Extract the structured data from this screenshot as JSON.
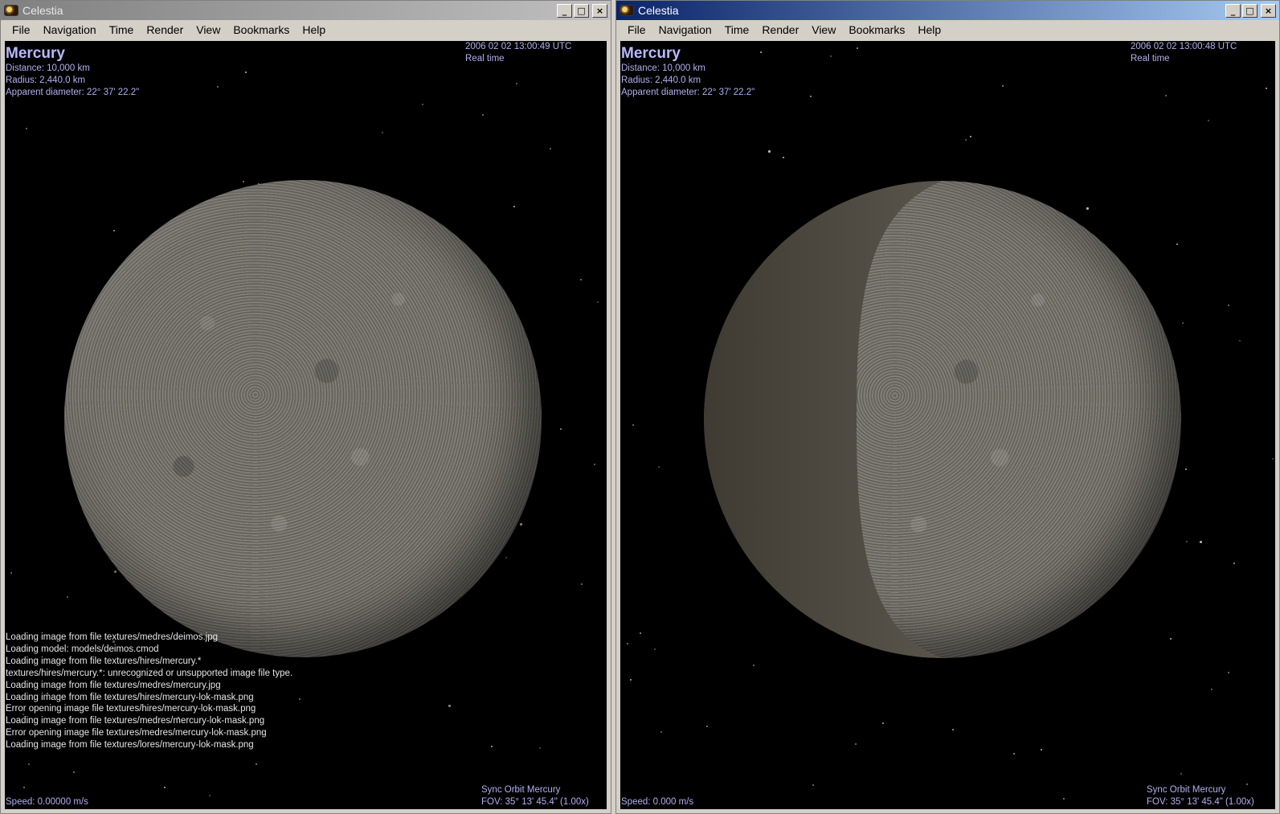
{
  "windows": [
    {
      "id": "left",
      "title": "Celestia",
      "active": false,
      "menu": [
        "File",
        "Navigation",
        "Time",
        "Render",
        "View",
        "Bookmarks",
        "Help"
      ],
      "hud": {
        "object_name": "Mercury",
        "distance": "Distance: 10,000 km",
        "radius": "Radius: 2,440.0 km",
        "apparent_diameter": "Apparent diameter: 22° 37' 22.2\"",
        "datetime": "2006 02 02 13:00:49 UTC",
        "time_mode": "Real time",
        "speed": "Speed: 0.00000 m/s",
        "sync": "Sync Orbit Mercury",
        "fov": "FOV: 35° 13' 45.4\" (1.00x)"
      },
      "console": [
        "Loading image from file textures/medres/deimos.jpg",
        "Loading model: models/deimos.cmod",
        "Loading image from file textures/hires/mercury.*",
        "textures/hires/mercury.*: unrecognized or unsupported image file type.",
        "Loading image from file textures/medres/mercury.jpg",
        "Loading image from file textures/hires/mercury-lok-mask.png",
        "Error opening image file textures/hires/mercury-lok-mask.png",
        "Loading image from file textures/medres/mercury-lok-mask.png",
        "Error opening image file textures/medres/mercury-lok-mask.png",
        "Loading image from file textures/lores/mercury-lok-mask.png"
      ]
    },
    {
      "id": "right",
      "title": "Celestia",
      "active": true,
      "menu": [
        "File",
        "Navigation",
        "Time",
        "Render",
        "View",
        "Bookmarks",
        "Help"
      ],
      "hud": {
        "object_name": "Mercury",
        "distance": "Distance: 10,000 km",
        "radius": "Radius: 2,440.0 km",
        "apparent_diameter": "Apparent diameter: 22° 37' 22.2\"",
        "datetime": "2006 02 02 13:00:48 UTC",
        "time_mode": "Real time",
        "speed": "Speed: 0.000 m/s",
        "sync": "Sync Orbit Mercury",
        "fov": "FOV: 35° 13' 45.4\" (1.00x)"
      }
    }
  ],
  "colors": {
    "hud_text": "#b0b0f0",
    "console_text": "#e6e6e6",
    "active_title": "#0a246a",
    "inactive_title": "#808080",
    "space": "#000000"
  },
  "icons": {
    "app": "celestia-app-icon",
    "minimize": "minimize-icon",
    "maximize": "maximize-icon",
    "close": "close-icon"
  }
}
